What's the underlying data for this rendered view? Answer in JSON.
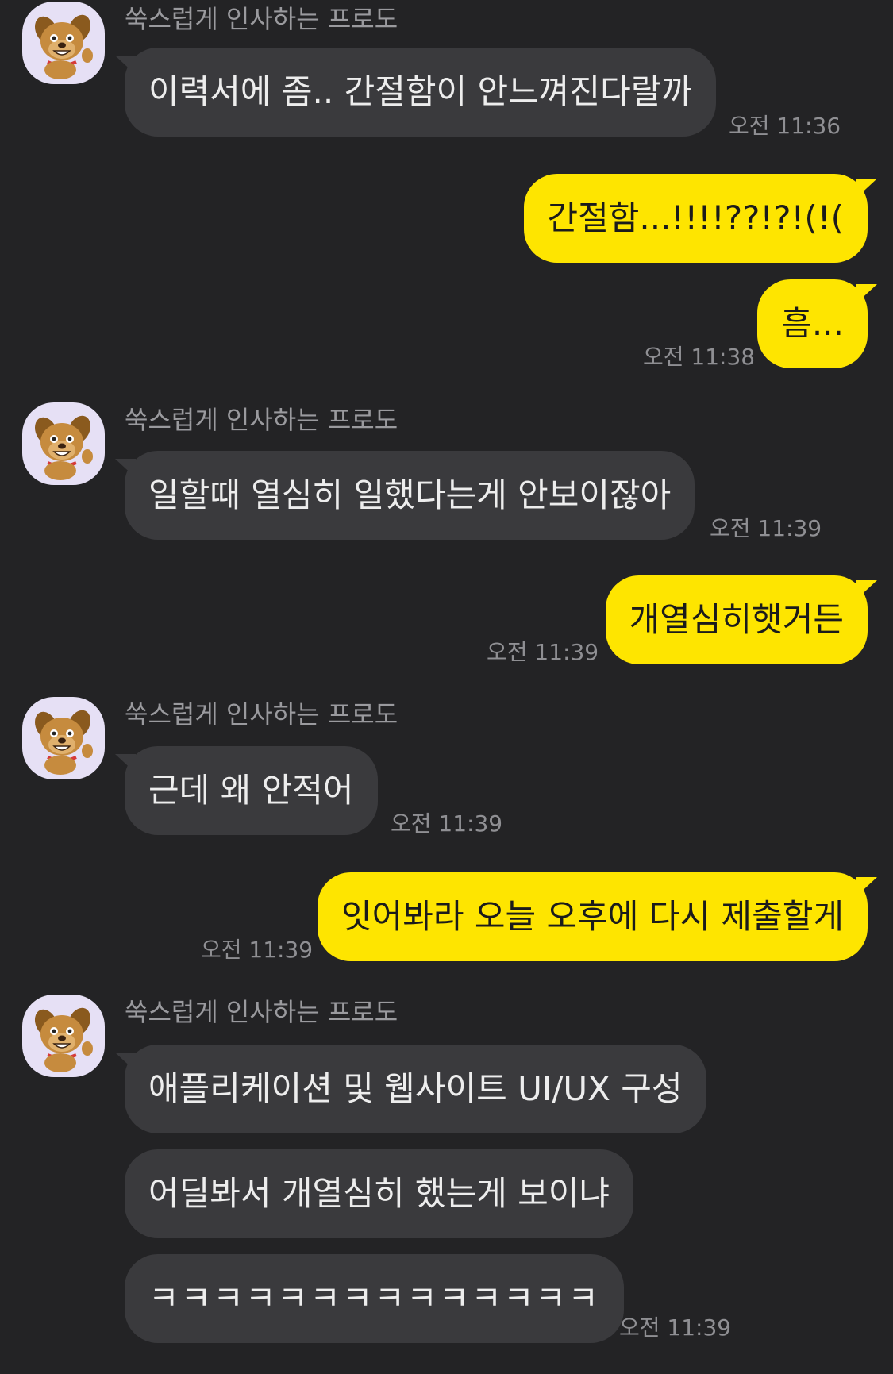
{
  "contact": {
    "name": "쑥스럽게 인사하는 프로도",
    "avatar_icon": "frodo-dog-character-icon"
  },
  "colors": {
    "background": "#232325",
    "incoming_bubble": "#3a3a3d",
    "outgoing_bubble": "#fee500",
    "timestamp": "#8f8f93"
  },
  "messages": [
    {
      "sender": "contact",
      "text": "이력서에 좀.. 간절함이 안느껴진다랄까",
      "time": "오전 11:36"
    },
    {
      "sender": "me",
      "text": "간절함...!!!!??!?!(!("
    },
    {
      "sender": "me",
      "text": "흠...",
      "time": "오전 11:38"
    },
    {
      "sender": "contact",
      "text": "일할때 열심히 일했다는게 안보이잖아",
      "time": "오전 11:39"
    },
    {
      "sender": "me",
      "text": "개열심히햇거든",
      "time": "오전 11:39"
    },
    {
      "sender": "contact",
      "text": "근데 왜 안적어",
      "time": "오전 11:39"
    },
    {
      "sender": "me",
      "text": "잇어봐라 오늘 오후에 다시 제출할게",
      "time": "오전 11:39"
    },
    {
      "sender": "contact",
      "text": "애플리케이션 및 웹사이트 UI/UX 구성"
    },
    {
      "sender": "contact",
      "text": "어딜봐서 개열심히 했는게 보이냐"
    },
    {
      "sender": "contact",
      "text": "ㅋㅋㅋㅋㅋㅋㅋㅋㅋㅋㅋㅋㅋㅋ",
      "time": "오전 11:39"
    }
  ]
}
